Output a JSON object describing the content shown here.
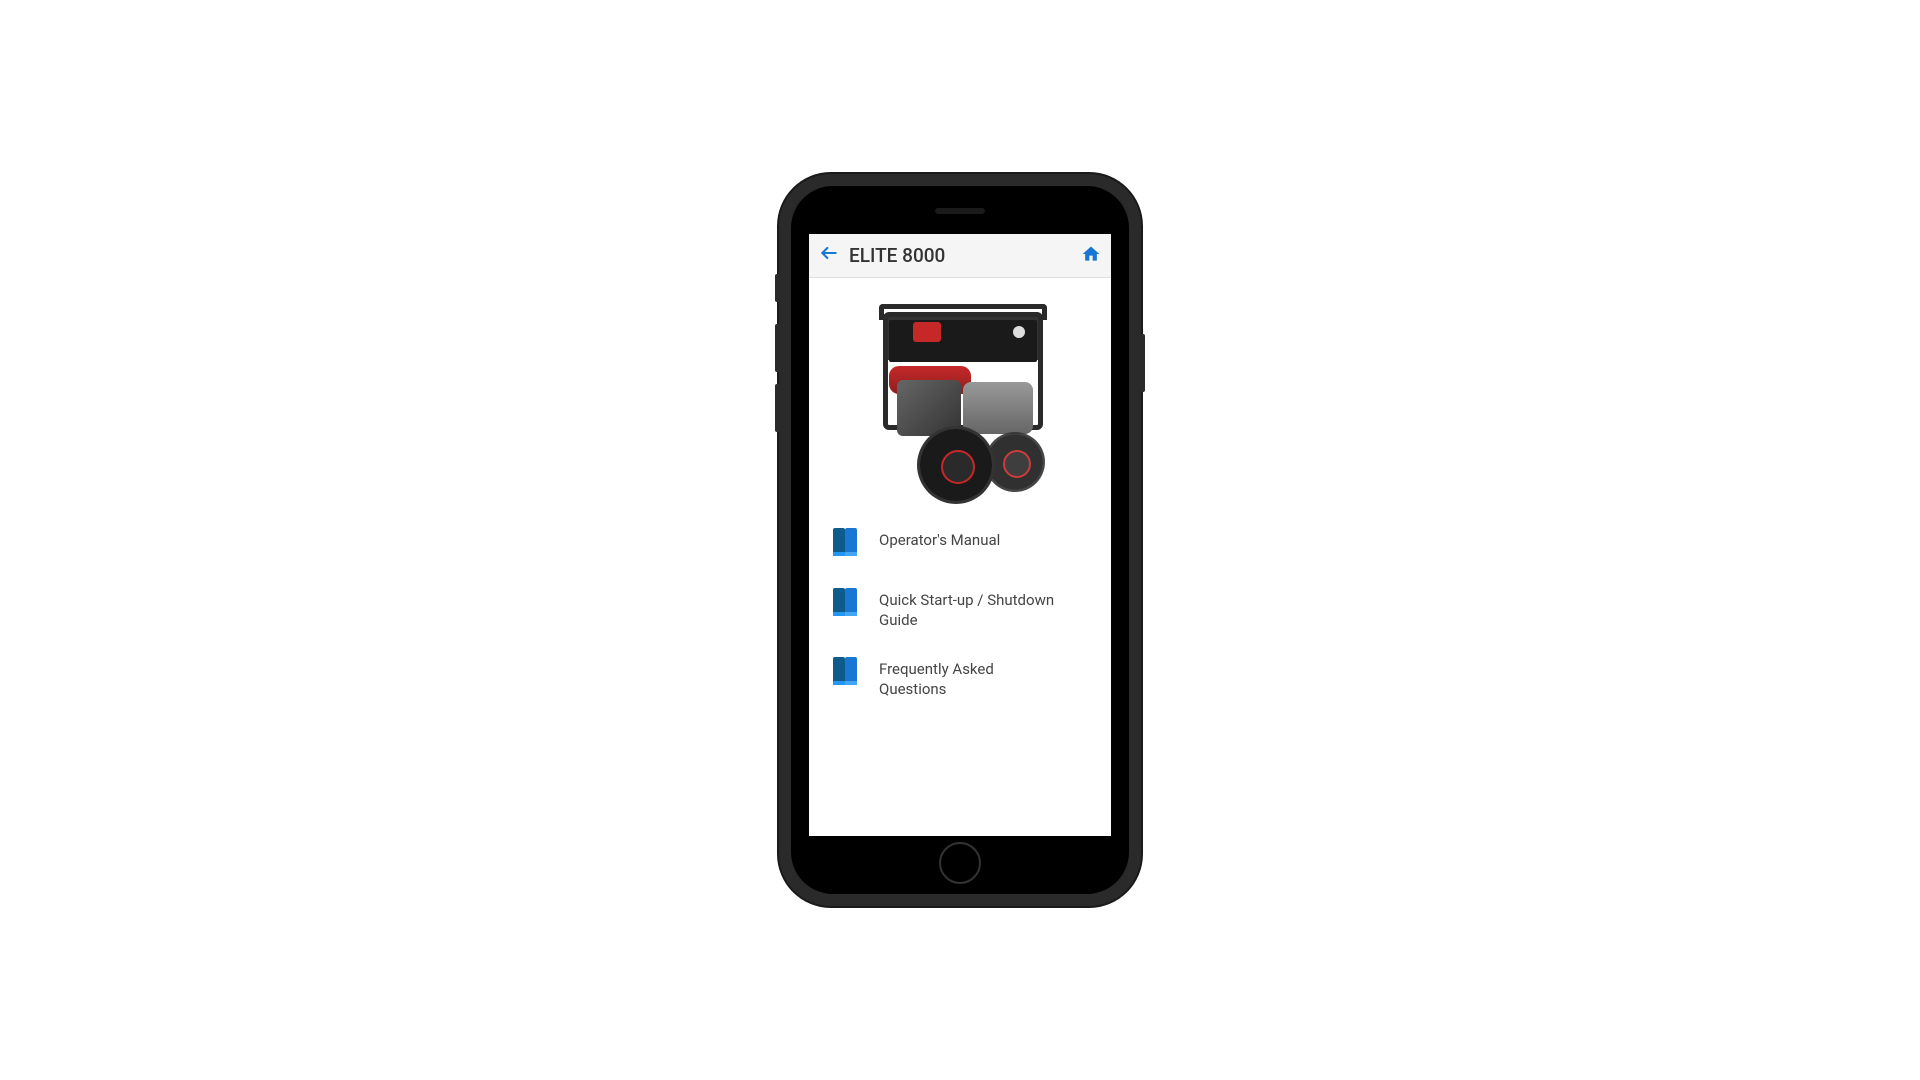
{
  "header": {
    "title": "ELITE 8000"
  },
  "menu": {
    "items": [
      {
        "label": "Operator's Manual"
      },
      {
        "label": "Quick Start-up / Shutdown Guide"
      },
      {
        "label": "Frequently Asked Questions"
      }
    ]
  }
}
